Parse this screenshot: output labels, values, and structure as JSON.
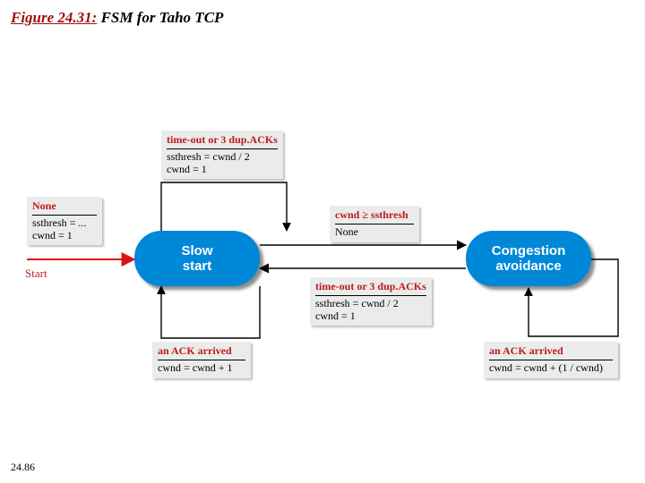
{
  "title": {
    "prefix": "Figure 24.31:",
    "rest": " FSM for Taho TCP"
  },
  "page_number": "24.86",
  "start_label": "Start",
  "states": {
    "slow_start": "Slow\nstart",
    "congestion_avoidance": "Congestion\navoidance"
  },
  "transitions": {
    "init": {
      "condition": "None",
      "actions": [
        "ssthresh = ...",
        "cwnd = 1"
      ]
    },
    "ss_loop_timeout": {
      "condition": "time-out or 3 dup.ACKs",
      "actions": [
        "ssthresh = cwnd / 2",
        "cwnd = 1"
      ]
    },
    "ss_ack": {
      "condition": "an ACK arrived",
      "actions": [
        "cwnd = cwnd + 1"
      ]
    },
    "ss_to_ca": {
      "condition": "cwnd ≥ ssthresh",
      "actions": [
        "None"
      ]
    },
    "ca_to_ss": {
      "condition": "time-out or 3 dup.ACKs",
      "actions": [
        "ssthresh = cwnd / 2",
        "cwnd = 1"
      ]
    },
    "ca_ack": {
      "condition": "an ACK arrived",
      "actions": [
        "cwnd = cwnd + (1 / cwnd)"
      ]
    }
  }
}
